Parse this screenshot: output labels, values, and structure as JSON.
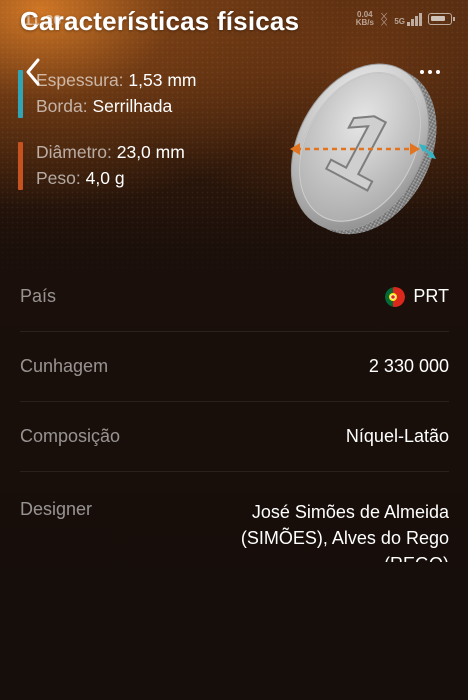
{
  "status_bar": {
    "time": "11:20",
    "net_speed_value": "0.04",
    "net_speed_unit": "KB/s",
    "network": "5G"
  },
  "header": {
    "title": "Características físicas"
  },
  "specs": {
    "thickness_label": "Espessura:",
    "thickness_value": "1,53 mm",
    "edge_label": "Borda:",
    "edge_value": "Serrilhada",
    "diameter_label": "Diâmetro:",
    "diameter_value": "23,0 mm",
    "weight_label": "Peso:",
    "weight_value": "4,0 g",
    "accent_colors": {
      "teal": "#2fa5b6",
      "orange": "#c6521f"
    }
  },
  "coin": {
    "numeral": "1"
  },
  "details": {
    "country_label": "País",
    "country_value": "PRT",
    "mintage_label": "Cunhagem",
    "mintage_value": "2 330 000",
    "composition_label": "Composição",
    "composition_value": "Níquel-Latão",
    "designer_label": "Designer",
    "designer_value": "José Simões de Almeida (SIMÕES), Alves do Rego (REGO)"
  }
}
